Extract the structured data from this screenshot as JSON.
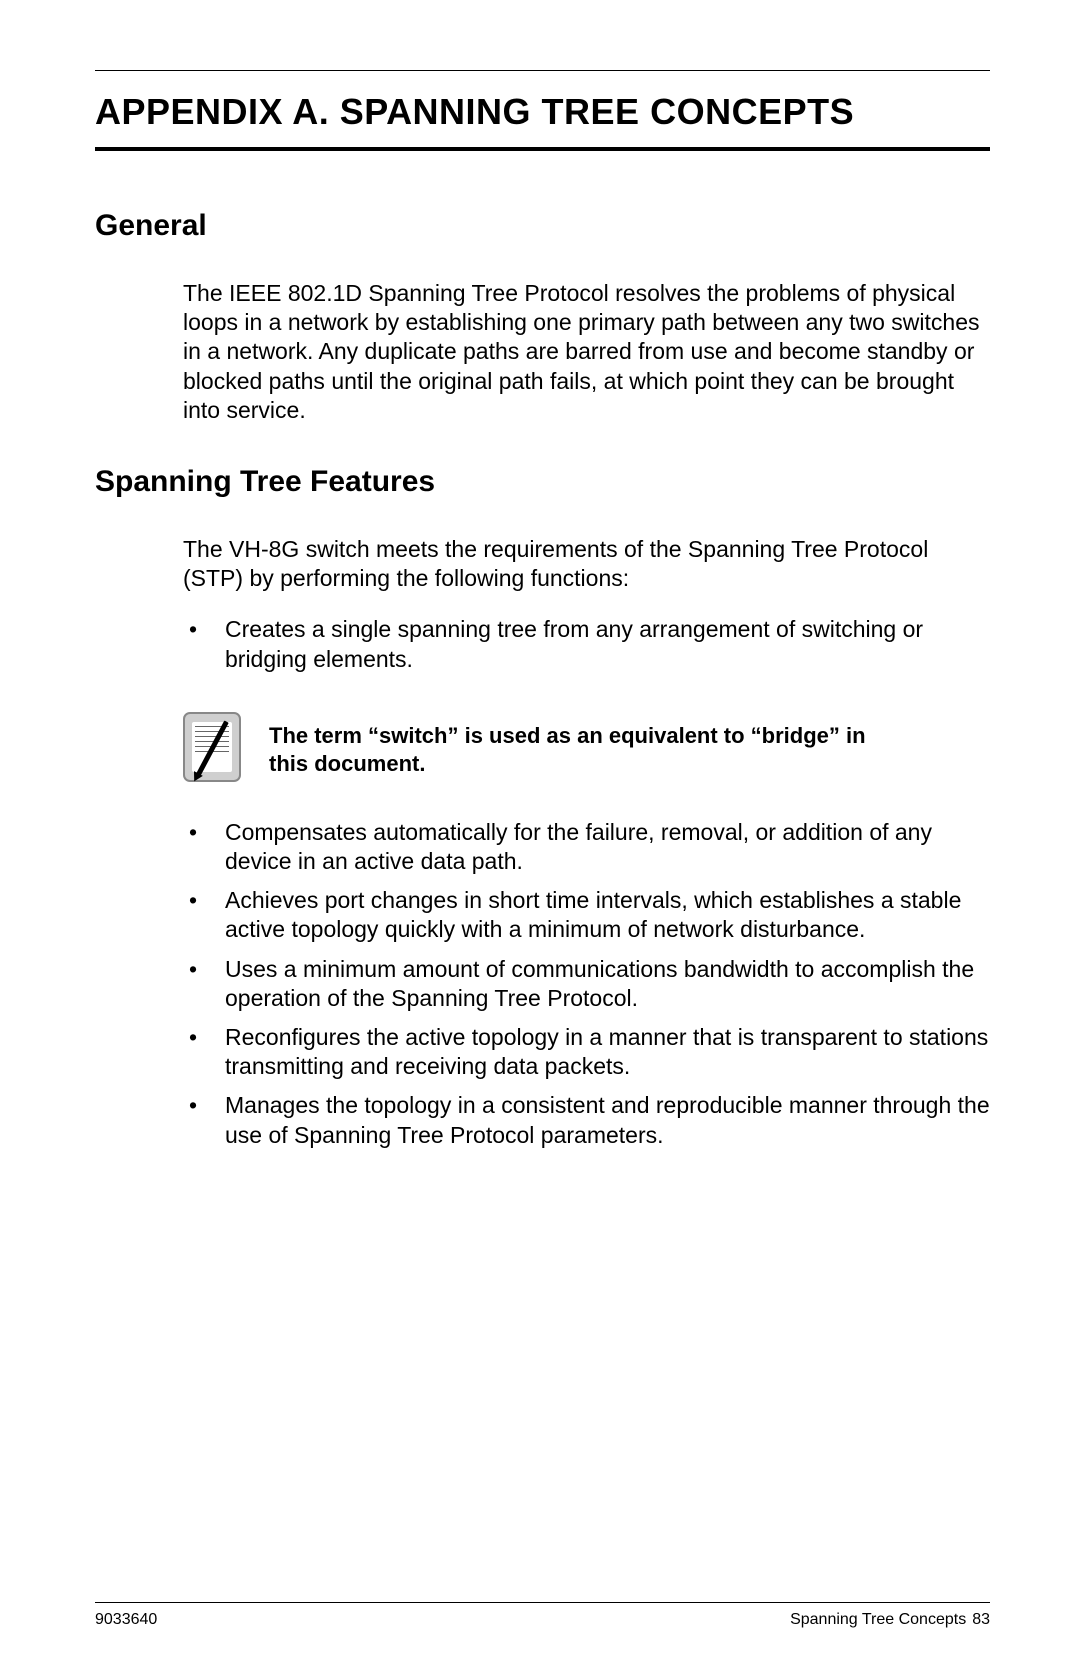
{
  "title": "APPENDIX A.  SPANNING TREE CONCEPTS",
  "sections": {
    "general": {
      "heading": "General",
      "paragraph": "The IEEE 802.1D Spanning Tree Protocol resolves the problems of physical loops in a network by establishing one primary path between any two switches in a network. Any duplicate paths are barred from use and become standby or blocked paths until the original path fails, at which point they can be brought into service."
    },
    "features": {
      "heading": "Spanning Tree Features",
      "intro": "The VH-8G switch meets the requirements of the Spanning Tree Protocol (STP) by performing the following functions:",
      "bullets_before_note": [
        "Creates a single spanning tree from any arrangement of switching or bridging elements."
      ],
      "note": "The term “switch” is used as an equivalent to “bridge” in this document.",
      "bullets_after_note": [
        "Compensates automatically for the failure, removal, or addition of any device in an active data path.",
        "Achieves port changes in short time intervals, which establishes a stable active topology quickly with a minimum of network disturbance.",
        "Uses a minimum amount of communications bandwidth to accomplish the operation of the Spanning Tree Protocol.",
        "Reconfigures the active topology in a manner that is transparent to stations transmitting and receiving data packets.",
        "Manages the topology in a consistent and reproducible manner through the use of Spanning Tree Protocol parameters."
      ]
    }
  },
  "footer": {
    "left": "9033640",
    "right_label": "Spanning Tree Concepts",
    "page_number": "83"
  }
}
